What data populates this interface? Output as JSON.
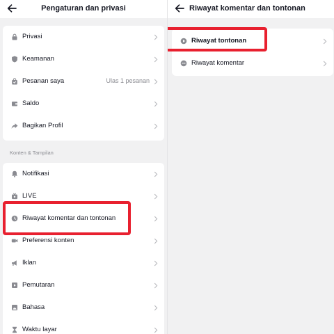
{
  "left_panel": {
    "title": "Pengaturan dan privasi",
    "account_items": [
      {
        "label": "Privasi",
        "icon": "lock-icon"
      },
      {
        "label": "Keamanan",
        "icon": "shield-icon"
      },
      {
        "label": "Pesanan saya",
        "icon": "shopping-bag-icon",
        "value": "Ulas 1 pesanan"
      },
      {
        "label": "Saldo",
        "icon": "wallet-icon"
      },
      {
        "label": "Bagikan Profil",
        "icon": "share-icon"
      }
    ],
    "section_header": "Konten & Tampilan",
    "content_items": [
      {
        "label": "Notifikasi",
        "icon": "bell-icon"
      },
      {
        "label": "LIVE",
        "icon": "live-tv-icon"
      },
      {
        "label": "Riwayat komentar dan tontonan",
        "icon": "clock-icon",
        "highlighted": true
      },
      {
        "label": "Preferensi konten",
        "icon": "video-camera-icon"
      },
      {
        "label": "Iklan",
        "icon": "megaphone-icon"
      },
      {
        "label": "Pemutaran",
        "icon": "play-box-icon"
      },
      {
        "label": "Bahasa",
        "icon": "image-icon"
      },
      {
        "label": "Waktu layar",
        "icon": "hourglass-icon"
      }
    ]
  },
  "right_panel": {
    "title": "Riwayat komentar dan tontonan",
    "items": [
      {
        "label": "Riwayat tontonan",
        "icon": "play-circle-icon",
        "highlighted": true
      },
      {
        "label": "Riwayat komentar",
        "icon": "comment-icon"
      }
    ]
  },
  "colors": {
    "highlight": "#e8202f",
    "background": "#f1f1f2",
    "card": "#ffffff",
    "text": "#161823",
    "secondary_text": "#8a8b91",
    "icon": "#8a8b91"
  }
}
